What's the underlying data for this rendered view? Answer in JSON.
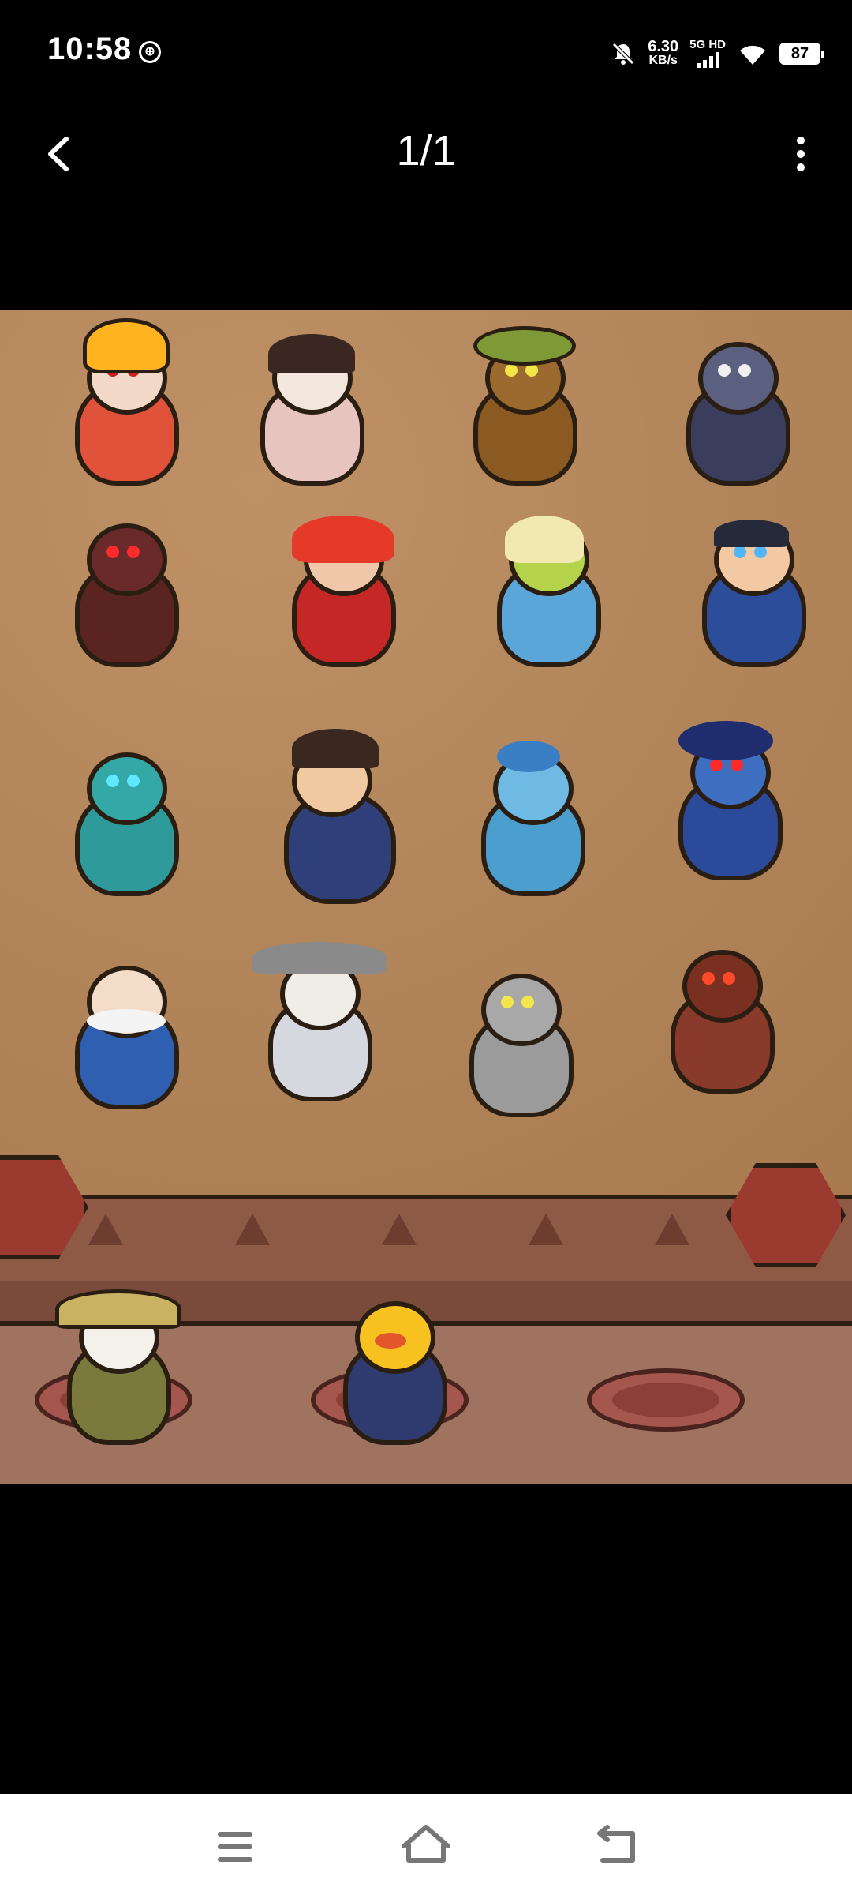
{
  "status_bar": {
    "time": "10:58",
    "net_speed_value": "6.30",
    "net_speed_unit": "KB/s",
    "network_label": "5G HD",
    "battery": "87"
  },
  "header": {
    "title": "1/1"
  },
  "viewer": {
    "image_description_icons": [
      "character-portraits"
    ]
  },
  "colors": {
    "background": "#000000",
    "board": "#b3865b",
    "nav_bar": "#ffffff"
  }
}
